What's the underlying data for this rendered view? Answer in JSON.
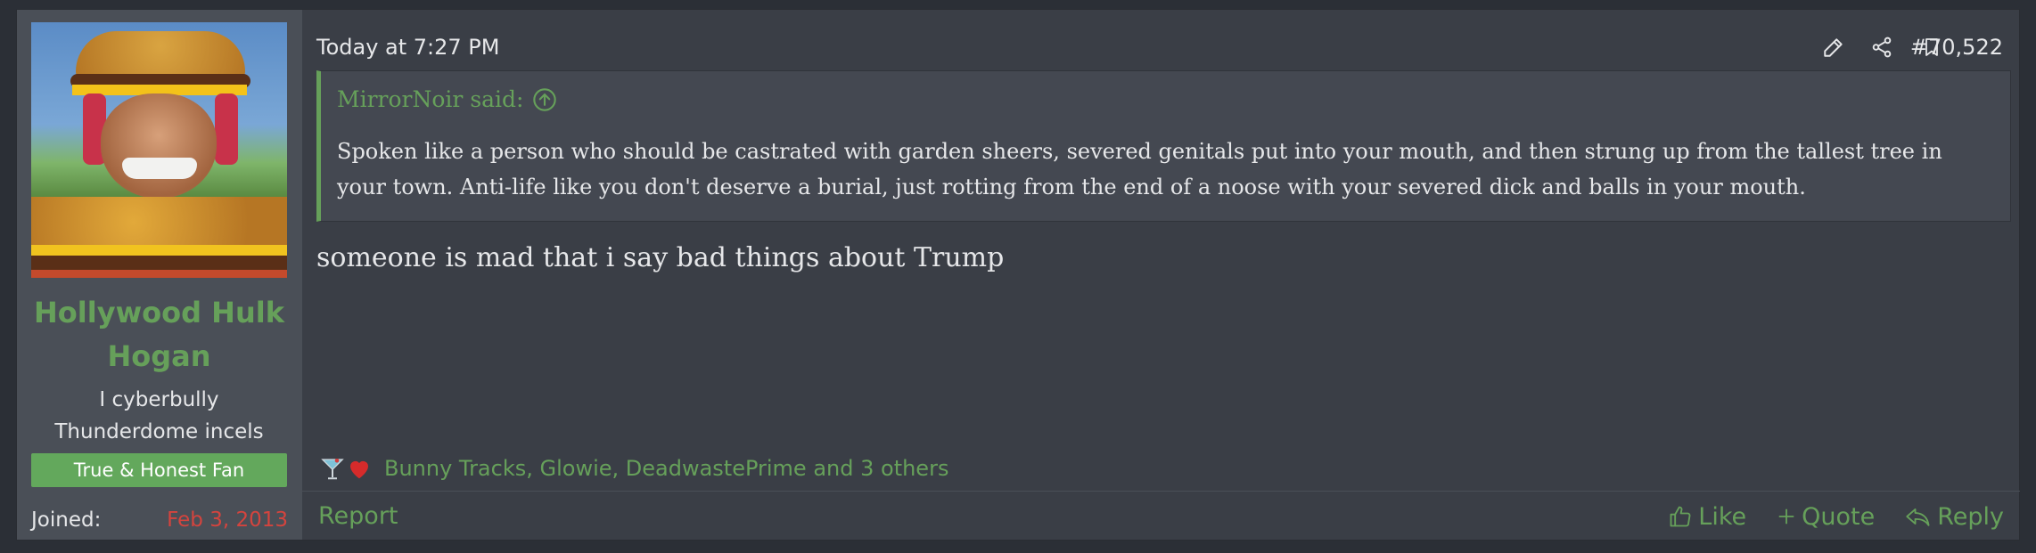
{
  "user": {
    "name": "Hollywood Hulk Hogan",
    "title": "I cyberbully Thunderdome incels",
    "banner": "True & Honest Fan",
    "joined_label": "Joined:",
    "joined_value": "Feb 3, 2013"
  },
  "post": {
    "timestamp": "Today at 7:27 PM",
    "number": "#70,522",
    "quote": {
      "author": "MirrorNoir said:",
      "text": "Spoken like a person who should be castrated with garden sheers, severed genitals put into your mouth, and then strung up from the tallest tree in your town. Anti-life like you don't deserve a burial, just rotting from the end of a noose with your severed dick and balls in your mouth."
    },
    "message": "someone is mad that i say bad things about Trump",
    "reactions_text": "Bunny Tracks, Glowie, DeadwastePrime and 3 others",
    "reaction_icons": [
      "cocktail-icon",
      "heart-icon"
    ]
  },
  "footer": {
    "report": "Report",
    "like": "Like",
    "quote": "Quote",
    "reply": "Reply"
  },
  "colors": {
    "accent_green": "#66a05a",
    "joined_red": "#d4443e",
    "panel": "#3a3e46",
    "sidebar": "#4a4f57"
  }
}
